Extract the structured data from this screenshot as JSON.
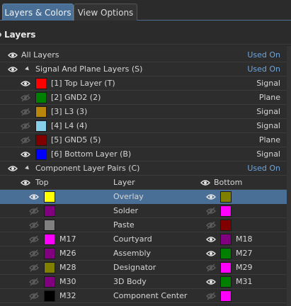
{
  "tabs": [
    {
      "label": "Layers & Colors",
      "active": true
    },
    {
      "label": "View Options",
      "active": false
    }
  ],
  "section_title": "Layers",
  "all_layers": {
    "label": "All Layers",
    "used": "Used On"
  },
  "signal_plane": {
    "label": "Signal And Plane Layers (S)",
    "used": "Used On",
    "layers": [
      {
        "name": "[1] Top Layer (T)",
        "type": "Signal",
        "color": "#ff0000",
        "visible": true
      },
      {
        "name": "[2] GND2 (2)",
        "type": "Plane",
        "color": "#008000",
        "visible": false
      },
      {
        "name": "[3] L3 (3)",
        "type": "Signal",
        "color": "#b8860b",
        "visible": false
      },
      {
        "name": "[4] L4 (4)",
        "type": "Signal",
        "color": "#87ceeb",
        "visible": false
      },
      {
        "name": "[5] GND5 (5)",
        "type": "Plane",
        "color": "#800000",
        "visible": false
      },
      {
        "name": "[6] Bottom Layer (B)",
        "type": "Signal",
        "color": "#0000ff",
        "visible": true
      }
    ]
  },
  "component_pairs": {
    "label": "Component Layer Pairs (C)",
    "used": "Used On",
    "header": {
      "top": "Top",
      "layer": "Layer",
      "bottom": "Bottom"
    },
    "rows": [
      {
        "top_code": "",
        "top_color": "#ffff00",
        "top_visible": true,
        "layer": "Overlay",
        "bottom_code": "",
        "bottom_color": "#808000",
        "bottom_visible": true,
        "selected": true
      },
      {
        "top_code": "",
        "top_color": "#800080",
        "top_visible": false,
        "layer": "Solder",
        "bottom_code": "",
        "bottom_color": "#ff00ff",
        "bottom_visible": false,
        "selected": false
      },
      {
        "top_code": "",
        "top_color": "#808080",
        "top_visible": false,
        "layer": "Paste",
        "bottom_code": "",
        "bottom_color": "#800000",
        "bottom_visible": false,
        "selected": false
      },
      {
        "top_code": "M17",
        "top_color": "#ff00ff",
        "top_visible": false,
        "layer": "Courtyard",
        "bottom_code": "M18",
        "bottom_color": "#800080",
        "bottom_visible": true,
        "selected": false
      },
      {
        "top_code": "M26",
        "top_color": "#800080",
        "top_visible": false,
        "layer": "Assembly",
        "bottom_code": "M27",
        "bottom_color": "#008000",
        "bottom_visible": true,
        "selected": false
      },
      {
        "top_code": "M28",
        "top_color": "#808000",
        "top_visible": false,
        "layer": "Designator",
        "bottom_code": "M29",
        "bottom_color": "#ff00ff",
        "bottom_visible": false,
        "selected": false
      },
      {
        "top_code": "M30",
        "top_color": "#800080",
        "top_visible": false,
        "layer": "3D Body",
        "bottom_code": "M31",
        "bottom_color": "#008000",
        "bottom_visible": true,
        "selected": false
      },
      {
        "top_code": "M32",
        "top_color": "#000000",
        "top_visible": false,
        "layer": "Component Center",
        "bottom_code": "",
        "bottom_color": "#ff00ff",
        "bottom_visible": false,
        "selected": false
      }
    ]
  },
  "colors": {
    "accent": "#4a6f96",
    "used_on": "#6ea6dc"
  }
}
